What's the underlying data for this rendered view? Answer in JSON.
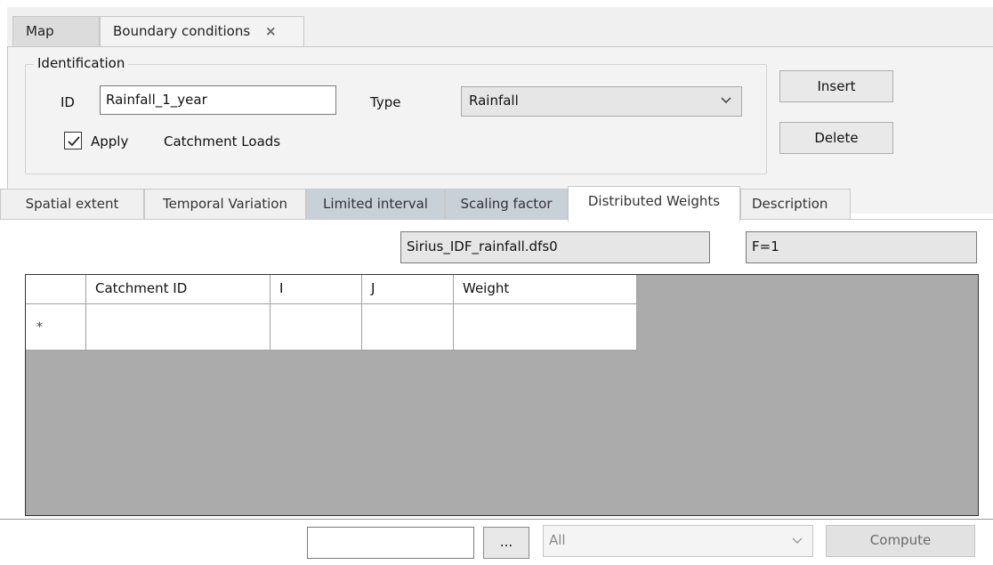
{
  "top_tabs": [
    {
      "label": "Map"
    },
    {
      "label": "Boundary conditions",
      "close": "×"
    }
  ],
  "identification": {
    "legend": "Identification",
    "id_label": "ID",
    "id_value": "Rainfall_1_year",
    "type_label": "Type",
    "type_value": "Rainfall",
    "apply_label": "Apply",
    "apply_checked": true,
    "catchment_loads_label": "Catchment Loads"
  },
  "buttons": {
    "insert": "Insert",
    "delete": "Delete"
  },
  "sub_tabs": [
    {
      "label": "Spatial extent"
    },
    {
      "label": "Temporal Variation"
    },
    {
      "label": "Limited interval"
    },
    {
      "label": "Scaling factor"
    },
    {
      "label": "Distributed Weights",
      "active": true
    },
    {
      "label": "Description"
    }
  ],
  "distributed": {
    "file_name": "Sirius_IDF_rainfall.dfs0",
    "factor": "F=1"
  },
  "grid": {
    "columns": [
      "",
      "Catchment ID",
      "I",
      "J",
      "Weight"
    ],
    "new_row_marker": "*"
  },
  "bottom": {
    "filter_value": "",
    "browse_label": "...",
    "scope_value": "All",
    "compute_label": "Compute"
  }
}
